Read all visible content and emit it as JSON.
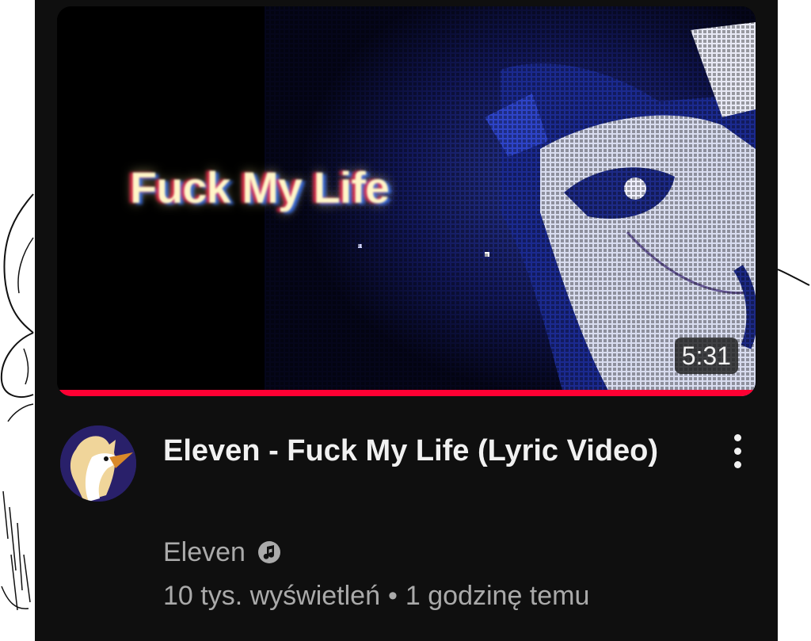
{
  "video": {
    "thumbnail_text": "Fuck My Life",
    "duration": "5:31",
    "watched_fraction": 1.0,
    "title": "Eleven - Fuck My Life (Lyric Video)",
    "channel": "Eleven",
    "channel_badge_icon": "music-note-icon",
    "views": "10 tys. wyświetleń",
    "separator": "•",
    "published": "1 godzinę temu"
  },
  "colors": {
    "card_background": "#0f0f0f",
    "progress_bar": "#ff0033",
    "secondary_text": "#aaaaaa",
    "primary_text": "#f1f1f1",
    "avatar_background": "#29206a"
  }
}
